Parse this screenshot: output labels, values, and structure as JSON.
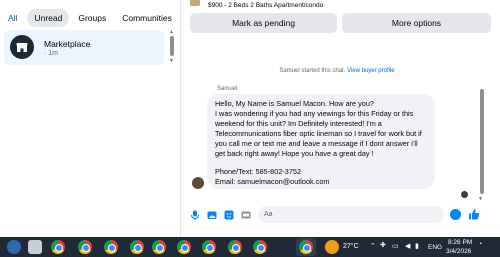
{
  "filters": [
    "All",
    "Unread",
    "Groups",
    "Communities"
  ],
  "chat_list": [
    {
      "name": "Marketplace",
      "time": "· 1m"
    }
  ],
  "listing": {
    "summary": "$900 - 2 Beds 2 Baths Apartment/condo"
  },
  "actions": {
    "mark_pending": "Mark as pending",
    "more_options": "More options"
  },
  "conversation": {
    "started_text": "Samuel started this chat.",
    "view_profile": "View buyer profile",
    "sender": "Samuel",
    "message_lines": [
      "Hello, My Name is Samuel Macon. How are you?",
      "I was wondering if you had any viewings for this Friday or this",
      "weekend for this unit? Im Definitely interested! I'm a",
      "Telecommunications fiber optic lineman so I travel for work but if",
      "you call me or text me and leave a message if I dont answer i'll",
      "get back right away! Hope you have a great day !"
    ],
    "message_lines_2": [
      "Phone/Text: 585-802-3752",
      "Email: samuelmacon@outlook.com"
    ]
  },
  "composer": {
    "placeholder": "Aa"
  },
  "taskbar": {
    "temperature": "27°C",
    "language": "ENG",
    "time": "8:26 PM",
    "date": "3/4/2026"
  },
  "colors": {
    "accent": "#0064d1",
    "bubble": "#f0f2f5",
    "selected": "#ebf5ff",
    "taskbar": "#1f2a36"
  }
}
